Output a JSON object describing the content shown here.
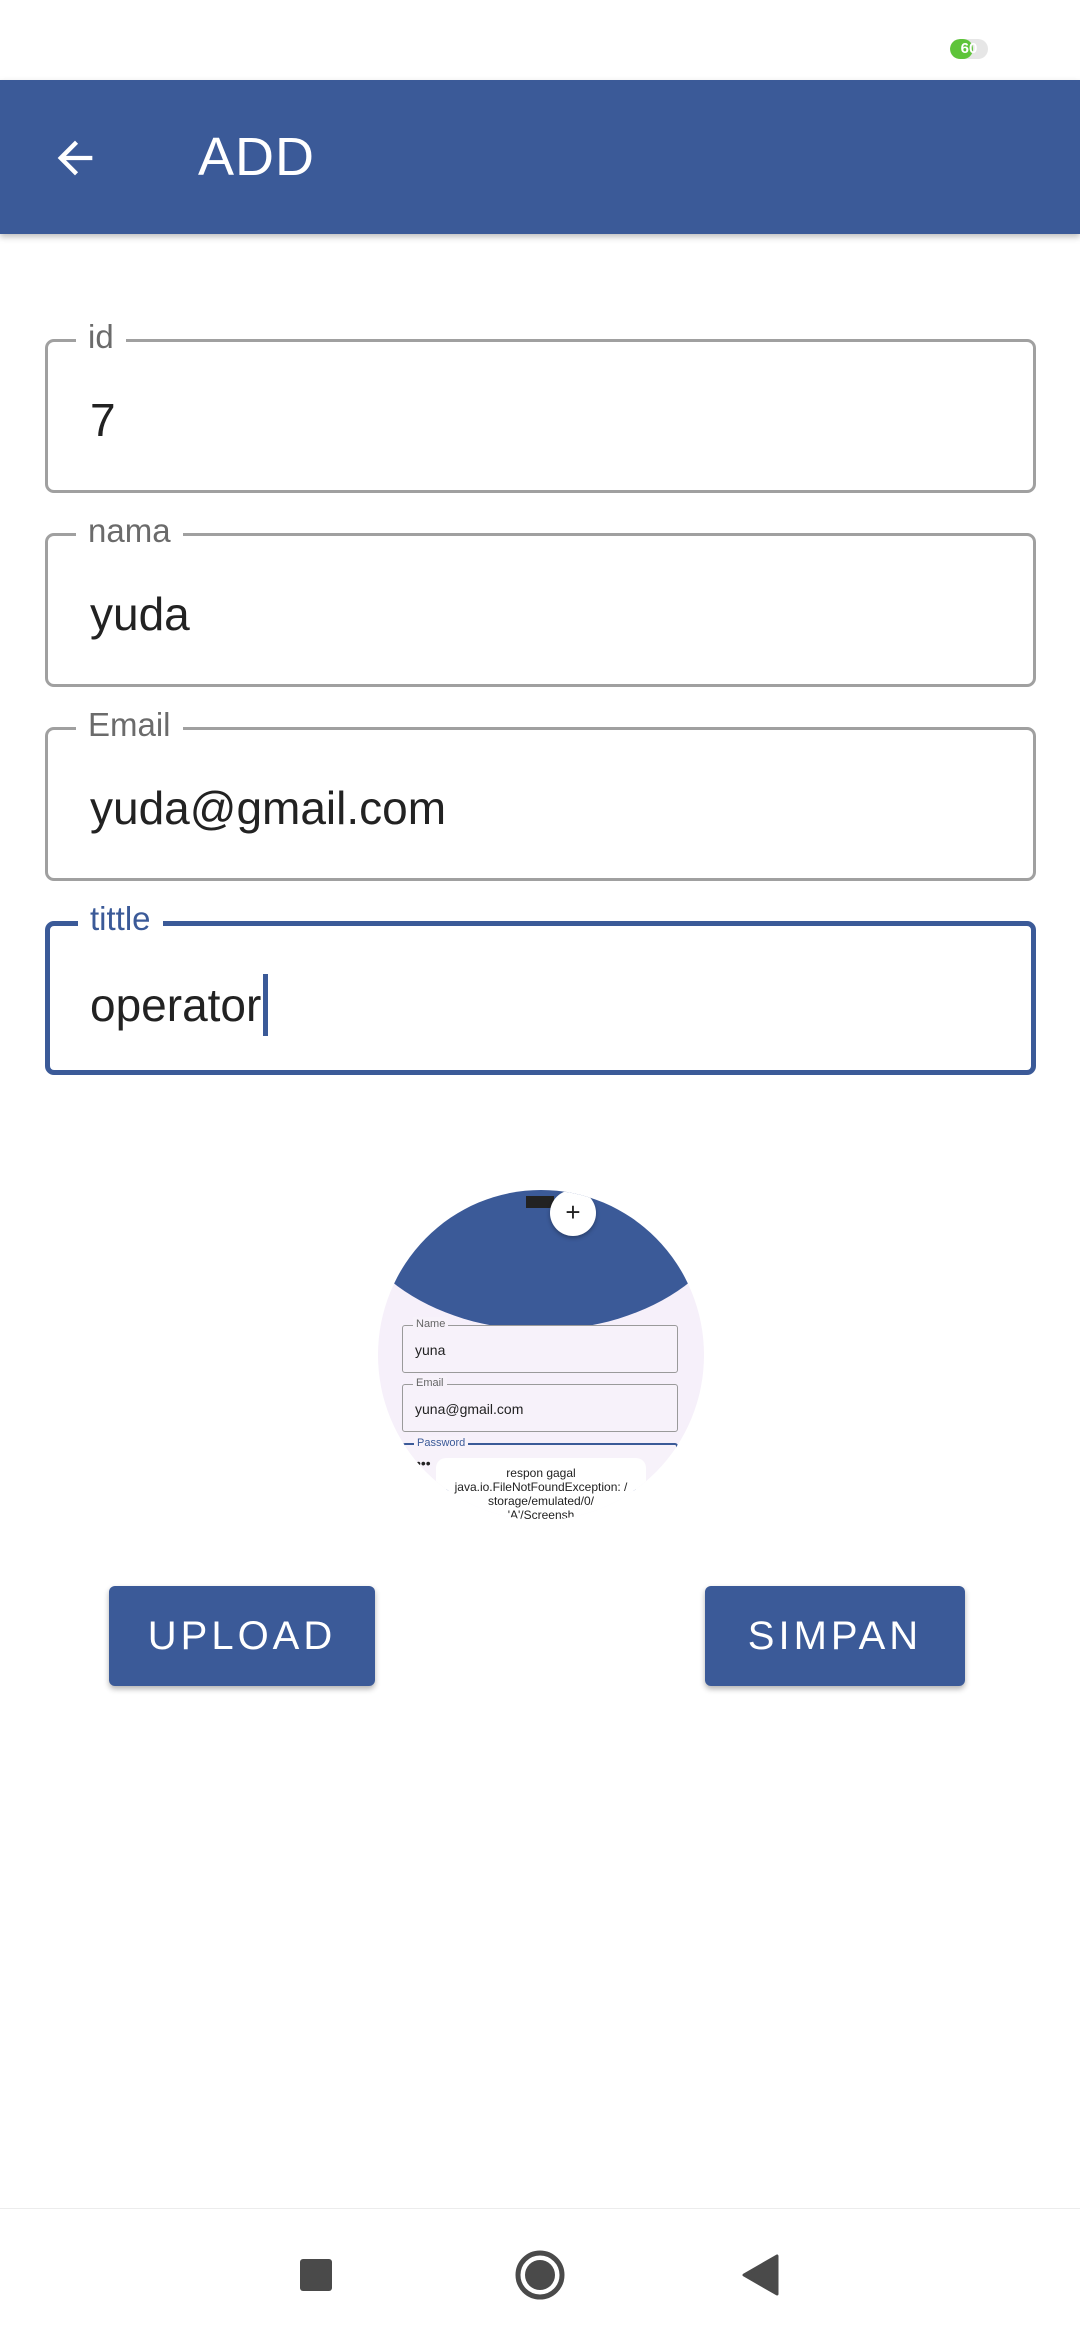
{
  "status_bar": {
    "battery_text": "60",
    "battery_level_percent": 60,
    "battery_color": "#5ec43a"
  },
  "app_bar": {
    "title": "ADD",
    "back_icon": "arrow-left-icon",
    "color": "#3b5a98"
  },
  "form": {
    "fields": [
      {
        "label": "id",
        "value": "7"
      },
      {
        "label": "nama",
        "value": "yuda"
      },
      {
        "label": "Email",
        "value": "yuda@gmail.com"
      },
      {
        "label": "tittle",
        "value": "operator"
      }
    ]
  },
  "preview": {
    "fab_label": "+",
    "fields": [
      {
        "label": "Name",
        "value": "yuna"
      },
      {
        "label": "Email",
        "value": "yuna@gmail.com"
      },
      {
        "label": "Password",
        "value": "•••"
      }
    ],
    "toast": {
      "line1": "respon gagal",
      "line2": "java.io.FileNotFoundException: /",
      "line3": "storage/emulated/0/",
      "line4": "'A'/Screensh"
    }
  },
  "buttons": {
    "upload_label": "UPLOAD",
    "simpan_label": "SIMPAN"
  },
  "nav_bar": {
    "recent_icon": "square-icon",
    "home_icon": "circle-icon",
    "back_icon": "triangle-back-icon"
  }
}
